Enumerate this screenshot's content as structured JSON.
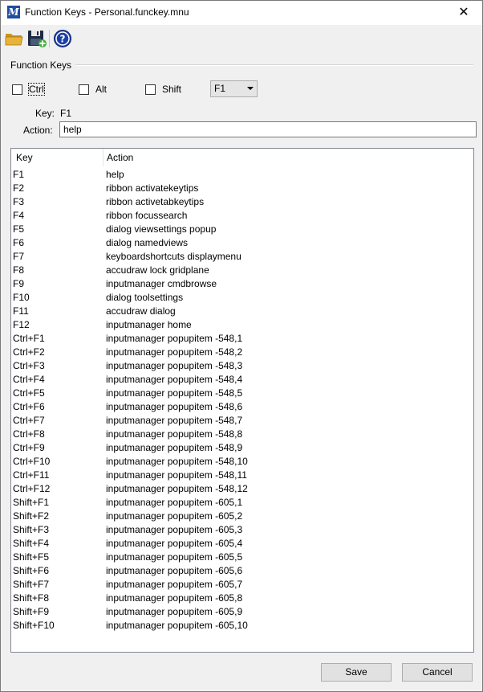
{
  "window": {
    "title": "Function Keys - Personal.funckey.mnu",
    "app_icon_letter": "M",
    "close_glyph": "✕"
  },
  "toolbar": {
    "open_icon": "folder-open-icon",
    "save_icon": "save-add-icon",
    "help_icon": "help-icon",
    "help_glyph": "?"
  },
  "group": {
    "label": "Function Keys"
  },
  "modifiers": {
    "ctrl": {
      "label": "Ctrl",
      "checked": false
    },
    "alt": {
      "label": "Alt",
      "checked": false
    },
    "shift": {
      "label": "Shift",
      "checked": false
    }
  },
  "key_select": {
    "value": "F1"
  },
  "key_field": {
    "caption": "Key:",
    "value": "F1"
  },
  "action_field": {
    "caption": "Action:",
    "value": "help"
  },
  "list": {
    "headers": {
      "key": "Key",
      "action": "Action"
    },
    "rows": [
      {
        "key": "F1",
        "action": "help"
      },
      {
        "key": "F2",
        "action": "ribbon activatekeytips"
      },
      {
        "key": "F3",
        "action": "ribbon activetabkeytips"
      },
      {
        "key": "F4",
        "action": "ribbon focussearch"
      },
      {
        "key": "F5",
        "action": "dialog viewsettings popup"
      },
      {
        "key": "F6",
        "action": "dialog namedviews"
      },
      {
        "key": "F7",
        "action": "keyboardshortcuts displaymenu"
      },
      {
        "key": "F8",
        "action": "accudraw lock gridplane"
      },
      {
        "key": "F9",
        "action": "inputmanager cmdbrowse"
      },
      {
        "key": "F10",
        "action": "dialog toolsettings"
      },
      {
        "key": "F11",
        "action": "accudraw dialog"
      },
      {
        "key": "F12",
        "action": "inputmanager home"
      },
      {
        "key": "Ctrl+F1",
        "action": "inputmanager popupitem -548,1"
      },
      {
        "key": "Ctrl+F2",
        "action": "inputmanager popupitem -548,2"
      },
      {
        "key": "Ctrl+F3",
        "action": "inputmanager popupitem -548,3"
      },
      {
        "key": "Ctrl+F4",
        "action": "inputmanager popupitem -548,4"
      },
      {
        "key": "Ctrl+F5",
        "action": "inputmanager popupitem -548,5"
      },
      {
        "key": "Ctrl+F6",
        "action": "inputmanager popupitem -548,6"
      },
      {
        "key": "Ctrl+F7",
        "action": "inputmanager popupitem -548,7"
      },
      {
        "key": "Ctrl+F8",
        "action": "inputmanager popupitem -548,8"
      },
      {
        "key": "Ctrl+F9",
        "action": "inputmanager popupitem -548,9"
      },
      {
        "key": "Ctrl+F10",
        "action": "inputmanager popupitem -548,10"
      },
      {
        "key": "Ctrl+F11",
        "action": "inputmanager popupitem -548,11"
      },
      {
        "key": "Ctrl+F12",
        "action": "inputmanager popupitem -548,12"
      },
      {
        "key": "Shift+F1",
        "action": "inputmanager popupitem -605,1"
      },
      {
        "key": "Shift+F2",
        "action": "inputmanager popupitem -605,2"
      },
      {
        "key": "Shift+F3",
        "action": "inputmanager popupitem -605,3"
      },
      {
        "key": "Shift+F4",
        "action": "inputmanager popupitem -605,4"
      },
      {
        "key": "Shift+F5",
        "action": "inputmanager popupitem -605,5"
      },
      {
        "key": "Shift+F6",
        "action": "inputmanager popupitem -605,6"
      },
      {
        "key": "Shift+F7",
        "action": "inputmanager popupitem -605,7"
      },
      {
        "key": "Shift+F8",
        "action": "inputmanager popupitem -605,8"
      },
      {
        "key": "Shift+F9",
        "action": "inputmanager popupitem -605,9"
      },
      {
        "key": "Shift+F10",
        "action": "inputmanager popupitem -605,10"
      }
    ]
  },
  "buttons": {
    "save": "Save",
    "cancel": "Cancel"
  },
  "colors": {
    "title_icon_bg": "#1f4ea1",
    "folder": "#e8b339",
    "disk": "#1e2a44",
    "help": "#1c3fa5",
    "save_plus": "#3fae3a"
  }
}
